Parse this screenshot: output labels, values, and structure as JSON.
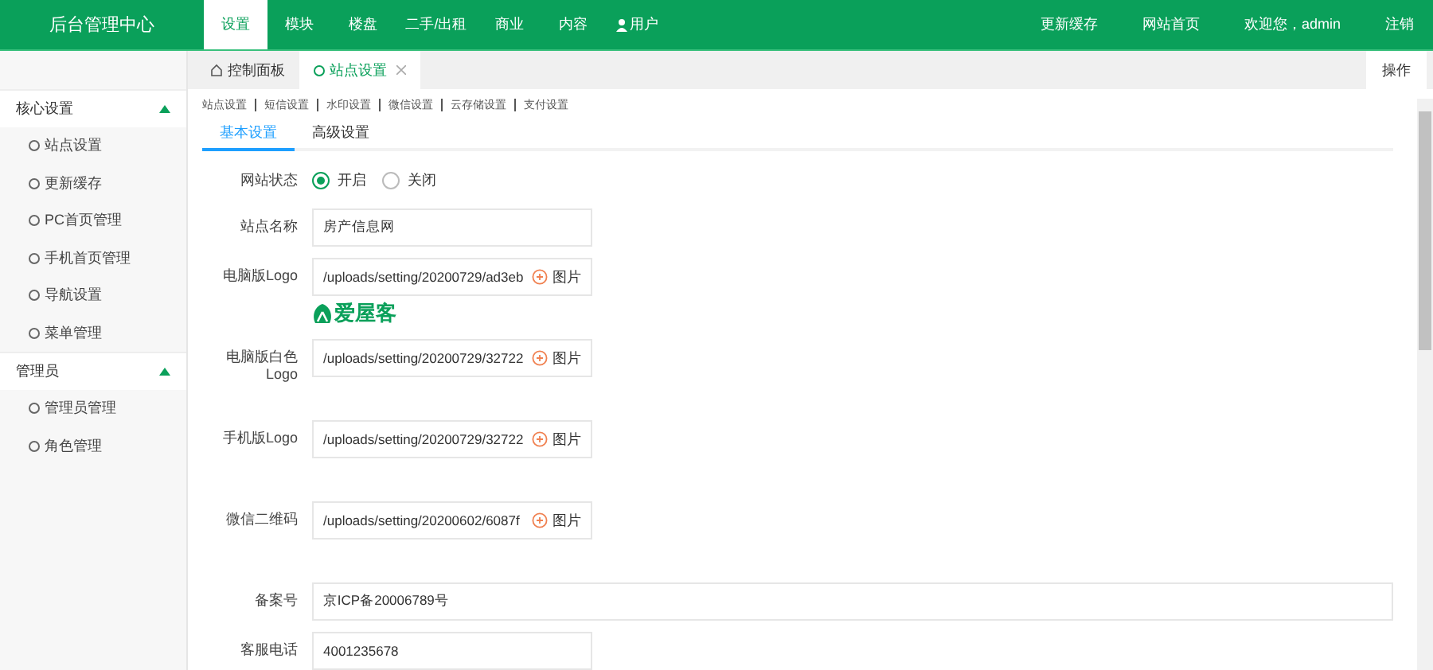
{
  "header": {
    "brand": "后台管理中心",
    "nav": [
      {
        "label": "设置",
        "selected": true,
        "kind": "text"
      },
      {
        "label": "模块",
        "selected": false,
        "kind": "text"
      },
      {
        "label": "楼盘",
        "selected": false,
        "kind": "text"
      },
      {
        "label": "二手/出租",
        "selected": false,
        "kind": "text"
      },
      {
        "label": "商业",
        "selected": false,
        "kind": "text"
      },
      {
        "label": "内容",
        "selected": false,
        "kind": "text"
      },
      {
        "label": "用户",
        "selected": false,
        "kind": "user"
      }
    ],
    "actions": [
      "更新缓存",
      "网站首页",
      "欢迎您，admin",
      "注销"
    ]
  },
  "sidebar": {
    "groups": [
      {
        "title": "核心设置",
        "expanded": true,
        "items": [
          {
            "label": "站点设置",
            "selected": false
          },
          {
            "label": "更新缓存",
            "selected": false
          },
          {
            "label": "PC首页管理",
            "selected": false
          },
          {
            "label": "手机首页管理",
            "selected": false
          },
          {
            "label": "导航设置",
            "selected": false
          },
          {
            "label": "菜单管理",
            "selected": false
          }
        ]
      },
      {
        "title": "管理员",
        "expanded": true,
        "items": [
          {
            "label": "管理员管理",
            "selected": false
          },
          {
            "label": "角色管理",
            "selected": false
          }
        ]
      }
    ]
  },
  "tabs": [
    {
      "label": "控制面板",
      "kind": "home",
      "selected": false,
      "closable": false
    },
    {
      "label": "站点设置",
      "kind": "page",
      "selected": true,
      "closable": true
    }
  ],
  "tab_menu": "操作",
  "sub_links": [
    "站点设置",
    "短信设置",
    "水印设置",
    "微信设置",
    "云存储设置",
    "支付设置"
  ],
  "sub_tabs": [
    {
      "label": "基本设置",
      "selected": true
    },
    {
      "label": "高级设置",
      "selected": false
    }
  ],
  "form": [
    {
      "kind": "radio",
      "label": "网站状态",
      "options": [
        {
          "label": "开启",
          "selected": true
        },
        {
          "label": "关闭",
          "selected": false
        }
      ]
    },
    {
      "kind": "text",
      "label": "站点名称",
      "value": "房产信息网",
      "wide": false
    },
    {
      "kind": "image",
      "label": "电脑版Logo",
      "value": "/uploads/setting/20200729/ad3eb",
      "button": "图片",
      "preview": "爱屋客"
    },
    {
      "kind": "image",
      "label": "电脑版白色Logo",
      "value": "/uploads/setting/20200729/32722",
      "button": "图片"
    },
    {
      "kind": "image",
      "label": "手机版Logo",
      "value": "/uploads/setting/20200729/32722",
      "button": "图片"
    },
    {
      "kind": "image",
      "label": "微信二维码",
      "value": "/uploads/setting/20200602/6087f",
      "button": "图片"
    },
    {
      "kind": "text",
      "label": "备案号",
      "value": "京ICP备20006789号",
      "wide": true
    },
    {
      "kind": "text",
      "label": "客服电话",
      "value": "4001235678",
      "wide": false
    }
  ]
}
